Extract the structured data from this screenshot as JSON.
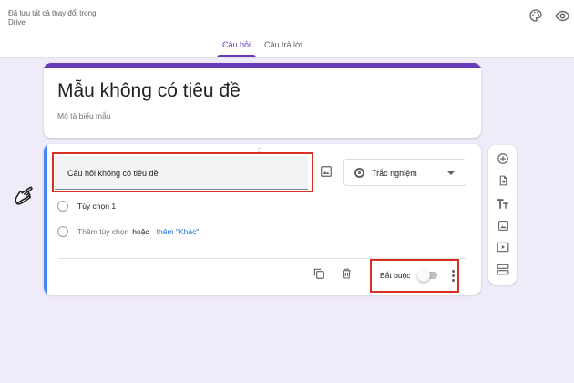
{
  "header": {
    "save_status": "Đã lưu tất cả thay đổi trong Drive",
    "palette_icon": "palette-icon",
    "preview_icon": "eye-icon"
  },
  "tabs": [
    {
      "label": "Câu hỏi",
      "active": true
    },
    {
      "label": "Câu trả lời",
      "active": false
    }
  ],
  "form": {
    "title": "Mẫu không có tiêu đề",
    "description_placeholder": "Mô tả biểu mẫu"
  },
  "question": {
    "title": "Câu hỏi không có tiêu đề",
    "type_label": "Trắc nghiệm",
    "options": [
      {
        "label": "Tùy chọn 1"
      }
    ],
    "add_option": {
      "label": "Thêm tùy chọn",
      "or": "hoặc",
      "add_other": "thêm \"Khác\""
    },
    "required_label": "Bắt buộc",
    "required": false
  },
  "side_toolbar": [
    "add-question-icon",
    "import-questions-icon",
    "add-title-icon",
    "add-image-icon",
    "add-video-icon",
    "add-section-icon"
  ],
  "colors": {
    "accent": "#673ab7",
    "background": "#f0ebf8",
    "question_bar": "#4285f4",
    "highlight_box": "#d93025",
    "link": "#1a73e8"
  }
}
